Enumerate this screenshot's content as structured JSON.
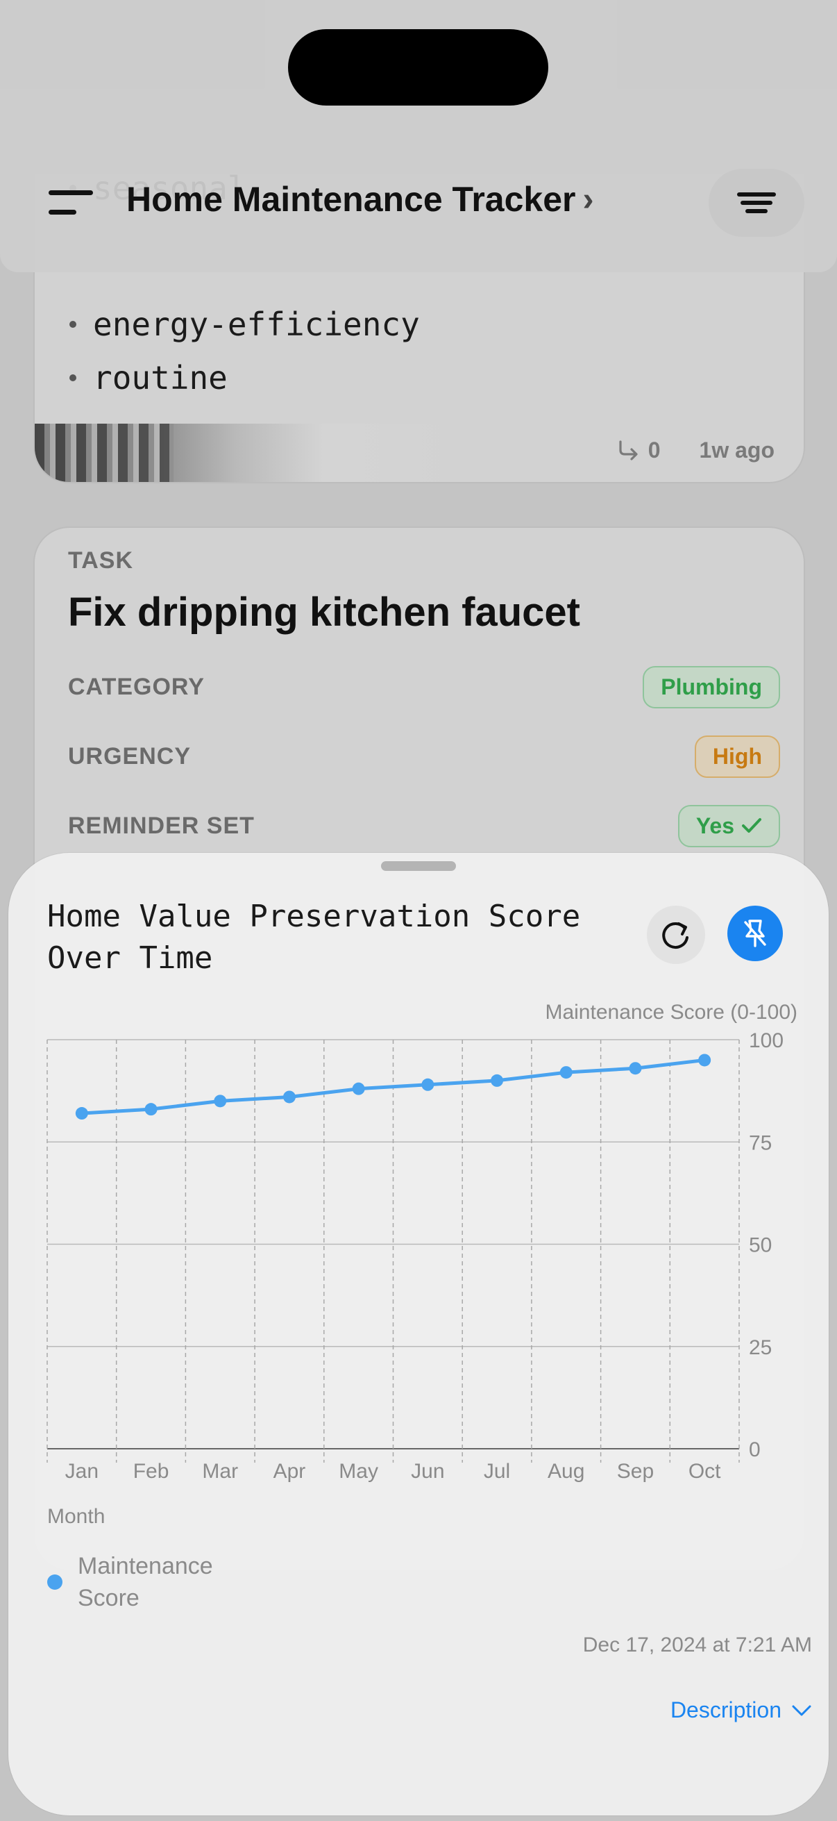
{
  "header": {
    "title": "Home Maintenance Tracker"
  },
  "card1": {
    "tags": [
      "seasonal",
      "energy-efficiency",
      "routine"
    ],
    "share_count": "0",
    "age": "1w ago"
  },
  "card2": {
    "type": "TASK",
    "title": "Fix dripping kitchen faucet",
    "fields": [
      {
        "label": "CATEGORY",
        "value": "Plumbing"
      },
      {
        "label": "URGENCY",
        "value": "High"
      },
      {
        "label": "REMINDER SET",
        "value": "Yes"
      }
    ]
  },
  "sheet": {
    "timestamp": "Dec 17, 2024 at 7:21 AM",
    "description_label": "Description"
  },
  "colors": {
    "accent": "#1a84f0",
    "series": "#4aa3ef",
    "green": "#2f9e49",
    "orange": "#c77a12"
  },
  "chart_data": {
    "type": "line",
    "title": "Home Value Preservation Score Over Time",
    "xlabel": "Month",
    "ylabel": "Maintenance Score (0-100)",
    "categories": [
      "Jan",
      "Feb",
      "Mar",
      "Apr",
      "May",
      "Jun",
      "Jul",
      "Aug",
      "Sep",
      "Oct"
    ],
    "series": [
      {
        "name": "Maintenance Score",
        "values": [
          82,
          83,
          85,
          86,
          88,
          89,
          90,
          92,
          93,
          95
        ]
      }
    ],
    "ylim": [
      0,
      100
    ],
    "yticks": [
      0,
      25,
      50,
      75,
      100
    ],
    "grid": true,
    "legend": "bottom-left"
  }
}
